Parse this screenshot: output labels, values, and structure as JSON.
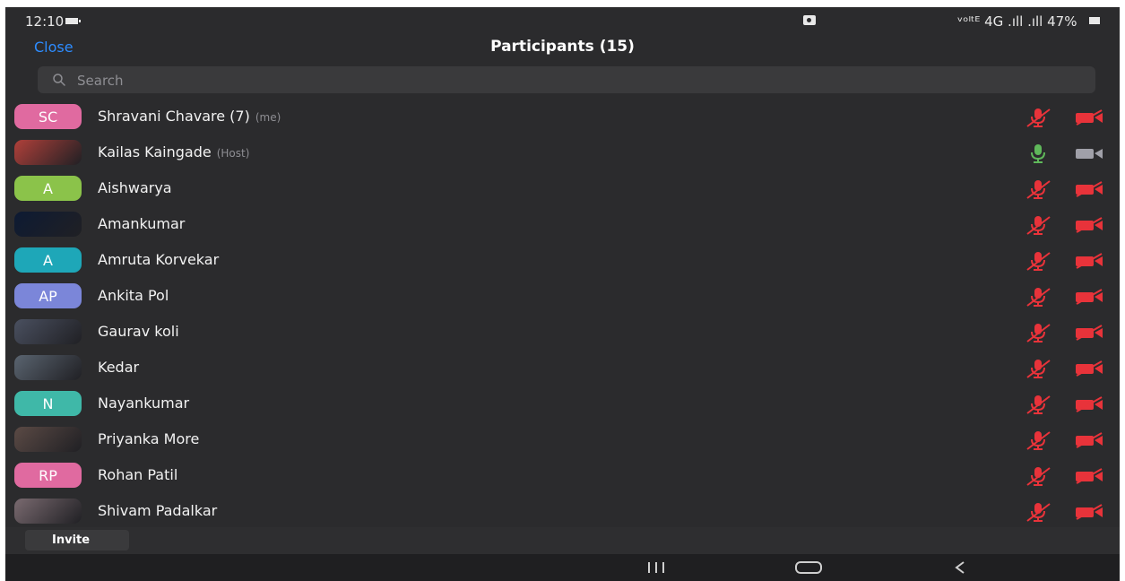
{
  "status_bar": {
    "time": "12:10",
    "signal_text": "ᵛᵒˡᵗᴱ 4G .ıll .ıll 47%",
    "battery": "47%"
  },
  "header": {
    "close_label": "Close",
    "title": "Participants (15)"
  },
  "search": {
    "placeholder": "Search"
  },
  "participants": [
    {
      "initials": "SC",
      "name": "Shravani Chavare (7)",
      "tag": "(me)",
      "avatar_color": "#e06aa0",
      "avatar_type": "initials",
      "mic": "muted",
      "video": "off"
    },
    {
      "initials": "",
      "name": "Kailas Kaingade",
      "tag": "(Host)",
      "avatar_color": "#b0403a",
      "avatar_type": "photo",
      "mic": "on",
      "video": "on"
    },
    {
      "initials": "A",
      "name": "Aishwarya",
      "tag": "",
      "avatar_color": "#8bc34a",
      "avatar_type": "initials",
      "mic": "muted",
      "video": "off"
    },
    {
      "initials": "",
      "name": "Amankumar",
      "tag": "",
      "avatar_color": "#0d1a33",
      "avatar_type": "photo",
      "mic": "muted",
      "video": "off"
    },
    {
      "initials": "A",
      "name": "Amruta Korvekar",
      "tag": "",
      "avatar_color": "#1ea7b8",
      "avatar_type": "initials",
      "mic": "muted",
      "video": "off"
    },
    {
      "initials": "AP",
      "name": "Ankita Pol",
      "tag": "",
      "avatar_color": "#7b86d9",
      "avatar_type": "initials",
      "mic": "muted",
      "video": "off"
    },
    {
      "initials": "",
      "name": "Gaurav koli",
      "tag": "",
      "avatar_color": "#4a5060",
      "avatar_type": "photo",
      "mic": "muted",
      "video": "off"
    },
    {
      "initials": "",
      "name": "Kedar",
      "tag": "",
      "avatar_color": "#5a6470",
      "avatar_type": "photo",
      "mic": "muted",
      "video": "off"
    },
    {
      "initials": "N",
      "name": "Nayankumar",
      "tag": "",
      "avatar_color": "#3fb8a8",
      "avatar_type": "initials",
      "mic": "muted",
      "video": "off"
    },
    {
      "initials": "",
      "name": "Priyanka More",
      "tag": "",
      "avatar_color": "#5b4a45",
      "avatar_type": "photo",
      "mic": "muted",
      "video": "off"
    },
    {
      "initials": "RP",
      "name": "Rohan Patil",
      "tag": "",
      "avatar_color": "#e06aa0",
      "avatar_type": "initials",
      "mic": "muted",
      "video": "off"
    },
    {
      "initials": "",
      "name": "Shivam Padalkar",
      "tag": "",
      "avatar_color": "#7a6a70",
      "avatar_type": "photo",
      "mic": "muted",
      "video": "off"
    }
  ],
  "footer": {
    "invite_label": "Invite"
  },
  "colors": {
    "background": "#2b2b2d",
    "accent": "#2d8cff",
    "muted_red": "#e8333a",
    "mic_on_green": "#5fb85a",
    "video_on_gray": "#a0a0a8"
  }
}
